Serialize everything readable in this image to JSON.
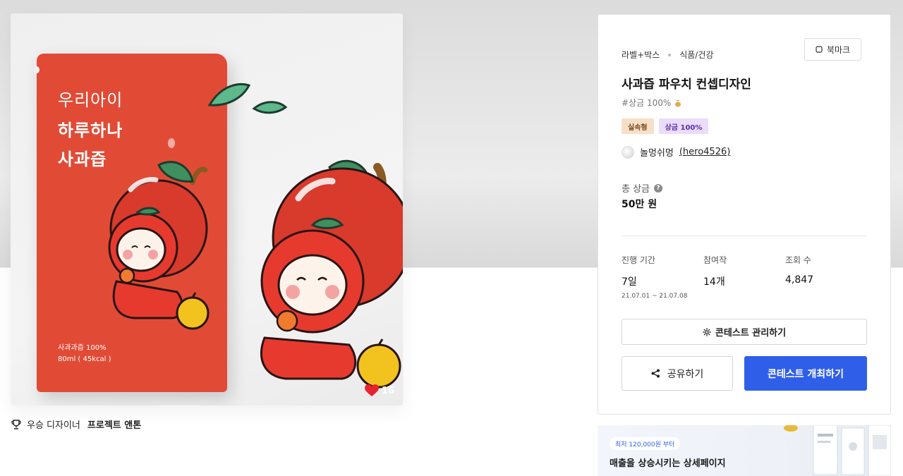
{
  "product_image": {
    "pouch_line1": "우리아이",
    "pouch_line2": "하루하나",
    "pouch_line3": "사과즙",
    "pouch_info_line1": "사과과즙 100%",
    "pouch_info_line2": "80ml ( 45kcal )",
    "like_count": "16",
    "like_icon": "heart-icon"
  },
  "award": {
    "icon": "trophy-icon",
    "label": "우승 디자이너",
    "designer": "프로젝트 앤톤"
  },
  "contest": {
    "breadcrumb": [
      "라벨+박스",
      "식품/건강"
    ],
    "bookmark_label": "북마크",
    "title": "사과즙 파우치 컨셉디자인",
    "prize_tag": "#상금 100%",
    "badges": [
      "실속형",
      "상금 100%"
    ],
    "host_name": "놀멍쉬멍",
    "host_handle": "(hero4526)",
    "prize_label": "총 상금",
    "prize_value": "50만 원",
    "stats": {
      "period_label": "진행 기간",
      "period_value": "7일",
      "period_dates": "21.07.01 ~ 21.07.08",
      "entries_label": "참여작",
      "entries_value": "14개",
      "views_label": "조회 수",
      "views_value": "4,847"
    },
    "manage_button": "콘테스트 관리하기",
    "share_button": "공유하기",
    "host_button": "콘테스트 개최하기"
  },
  "banner": {
    "pill": "최저 120,000원 부터",
    "headline": "매출을 상승시키는 상세페이지"
  },
  "colors": {
    "accent_blue": "#2f5fe8",
    "pouch_red": "#e14b36",
    "heart_red": "#e8232f"
  }
}
